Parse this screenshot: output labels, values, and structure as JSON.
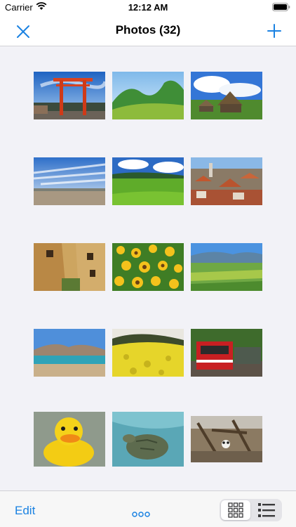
{
  "status_bar": {
    "carrier": "Carrier",
    "time": "12:12 AM"
  },
  "nav": {
    "title": "Photos (32)",
    "close_icon": "close-icon",
    "add_icon": "plus-icon"
  },
  "photos": [
    {
      "subject": "torii-gate"
    },
    {
      "subject": "green-hills"
    },
    {
      "subject": "thatched-farmhouse"
    },
    {
      "subject": "beach-clouds"
    },
    {
      "subject": "green-meadow"
    },
    {
      "subject": "town-rooftops"
    },
    {
      "subject": "ruined-buildings"
    },
    {
      "subject": "sunflowers"
    },
    {
      "subject": "valley-fields"
    },
    {
      "subject": "mountain-lake"
    },
    {
      "subject": "rapeseed-field"
    },
    {
      "subject": "red-train"
    },
    {
      "subject": "rubber-duck"
    },
    {
      "subject": "sea-turtle"
    },
    {
      "subject": "panda-enclosure"
    }
  ],
  "toolbar": {
    "edit_label": "Edit",
    "more_icon": "ellipsis-icon",
    "grid_view_icon": "grid-view-icon",
    "list_view_icon": "list-view-icon",
    "selected_view": "grid"
  },
  "colors": {
    "accent": "#1a82e2",
    "background": "#f2f2f7"
  }
}
